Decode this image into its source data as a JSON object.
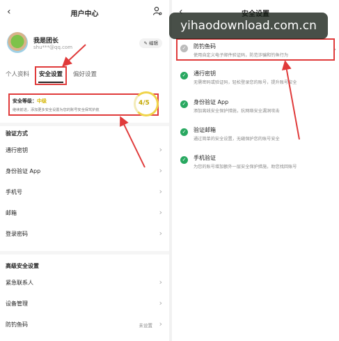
{
  "left": {
    "header": {
      "title": "用户中心",
      "back_icon": "chevron-left-icon",
      "user_icon": "user-settings-icon"
    },
    "profile": {
      "name": "我是团长",
      "email": "shu***@qq.com",
      "edit_label": "编辑"
    },
    "tabs": [
      "个人资料",
      "安全设置",
      "偏好设置"
    ],
    "active_tab": "安全设置",
    "security": {
      "level_label": "安全等级：",
      "level_value": "中级",
      "description": "继续前进，添加更多安全设置为您的账号安全保驾护航",
      "score": "4/5",
      "score_fraction": 0.8
    },
    "verify_section": {
      "title": "验证方式",
      "items": [
        {
          "label": "通行密钥"
        },
        {
          "label": "身份验证 App"
        },
        {
          "label": "手机号"
        },
        {
          "label": "邮箱"
        },
        {
          "label": "登录密码"
        }
      ]
    },
    "advanced_section": {
      "title": "高级安全设置",
      "items": [
        {
          "label": "紧急联系人",
          "value": ""
        },
        {
          "label": "设备管理",
          "value": ""
        },
        {
          "label": "防钓鱼码",
          "value": "未设置"
        }
      ]
    }
  },
  "right": {
    "header": {
      "title": "安全设置",
      "back_icon": "chevron-left-icon"
    },
    "features": [
      {
        "title": "防钓鱼码",
        "desc": "使用自定义电子邮件验证码，防范诈骗和钓鱼行为",
        "enabled": false
      },
      {
        "title": "通行密钥",
        "desc": "无需密码或验证码，轻松登录您的账号，提升账号安全",
        "enabled": true
      },
      {
        "title": "身份验证 App",
        "desc": "添加离线安全保护措施，抗网络安全漏洞攻击",
        "enabled": true
      },
      {
        "title": "验证邮箱",
        "desc": "通过简单的安全设置，无缝保护您的账号安全",
        "enabled": true
      },
      {
        "title": "手机验证",
        "desc": "为您的账号增加额外一层安全保护措施，助您找回账号",
        "enabled": true
      }
    ]
  },
  "watermark": "yihaodownload.com.cn",
  "colors": {
    "highlight": "#e03a3a",
    "check": "#28a860",
    "level": "#d4b400"
  }
}
